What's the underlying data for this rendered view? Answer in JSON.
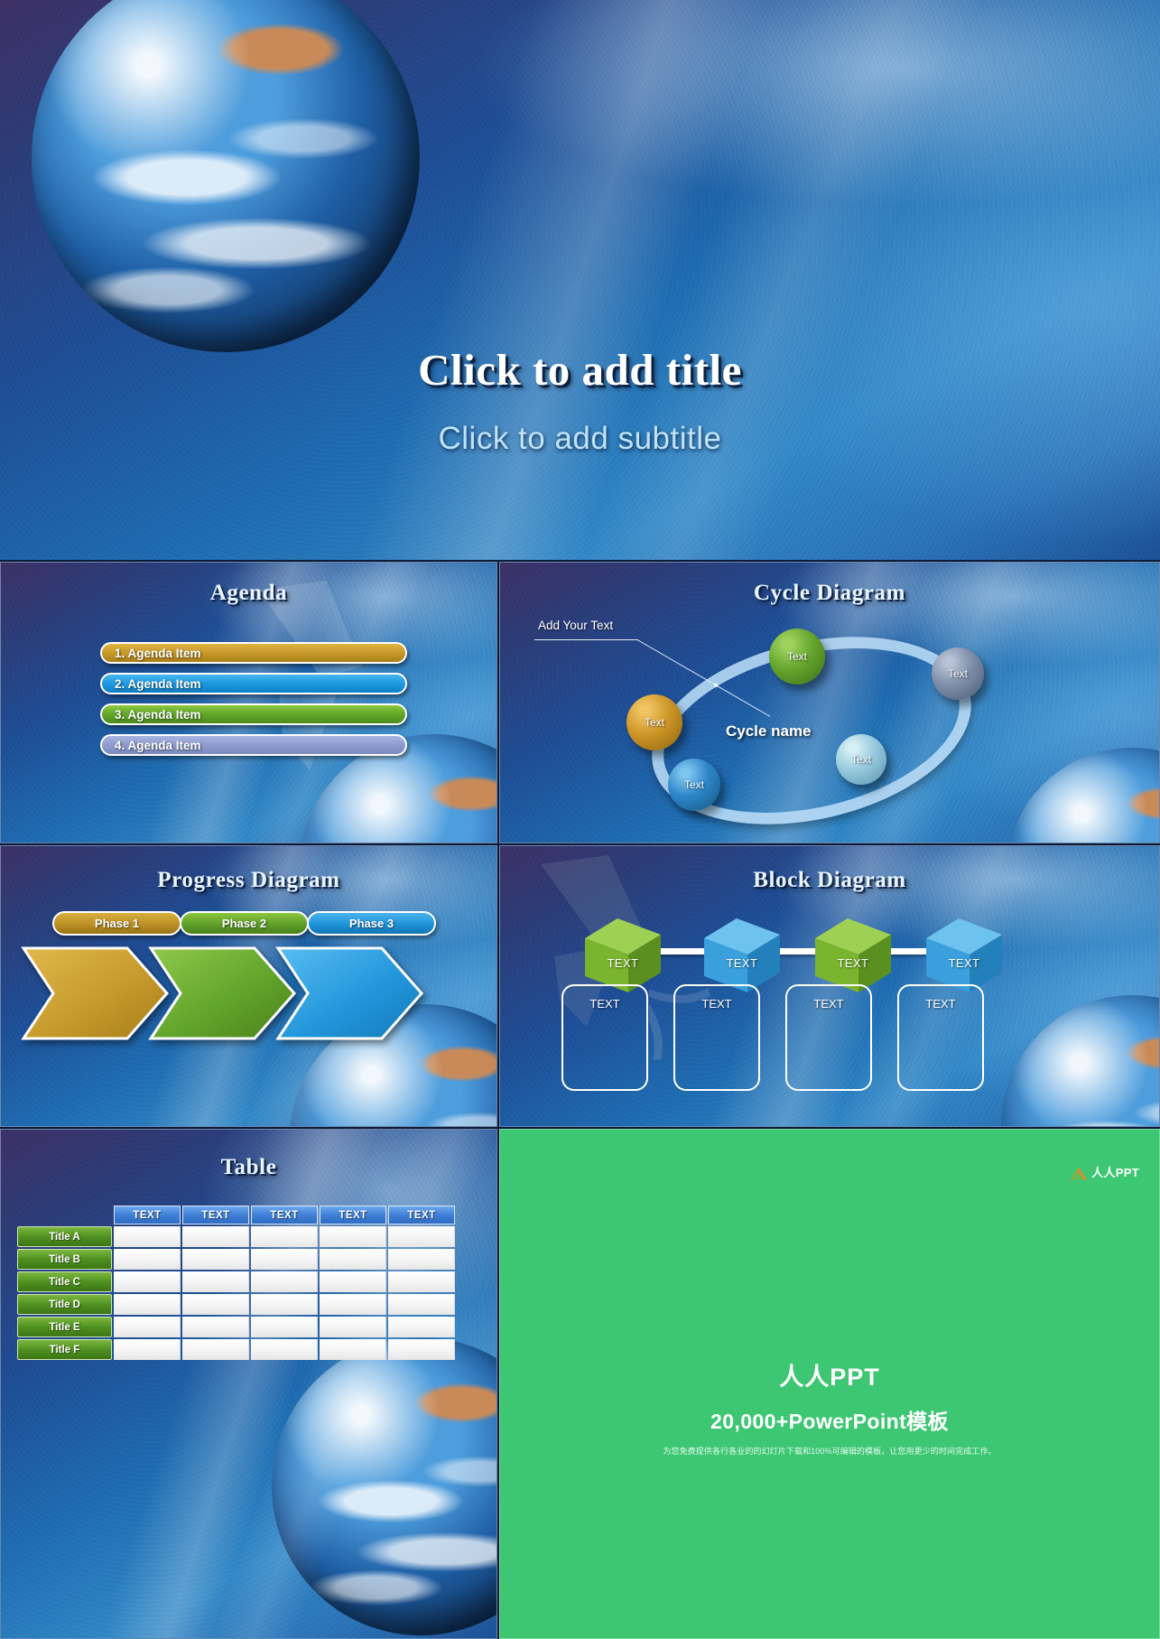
{
  "deck": {
    "title_slide": {
      "title": "Click to add title",
      "subtitle": "Click to add subtitle"
    },
    "slides": [
      {
        "name": "agenda",
        "heading": "Agenda",
        "items": [
          {
            "label": "1. Agenda Item",
            "color": "#c79a2a"
          },
          {
            "label": "2. Agenda Item",
            "color": "#1f9ae0"
          },
          {
            "label": "3. Agenda Item",
            "color": "#63a82b"
          },
          {
            "label": "4. Agenda Item",
            "color": "#8f9ccf"
          }
        ]
      },
      {
        "name": "cycle",
        "heading": "Cycle Diagram",
        "callout": "Add Your Text",
        "center_label": "Cycle name",
        "nodes": [
          {
            "label": "Text",
            "color": "#66a62e"
          },
          {
            "label": "Text",
            "color": "#7e8ea9"
          },
          {
            "label": "Text",
            "color": "#cd9626"
          },
          {
            "label": "Text",
            "color": "#96c9dd"
          },
          {
            "label": "Text",
            "color": "#2d86c8"
          }
        ]
      },
      {
        "name": "progress",
        "heading": "Progress Diagram",
        "phases": [
          {
            "label": "Phase 1",
            "color": "#bb9026"
          },
          {
            "label": "Phase 2",
            "color": "#5f9f2b"
          },
          {
            "label": "Phase 3",
            "color": "#1f93d8"
          }
        ]
      },
      {
        "name": "block",
        "heading": "Block Diagram",
        "cubes": [
          {
            "label": "TEXT",
            "color": "#7ab52f"
          },
          {
            "label": "TEXT",
            "color": "#39a0dd"
          },
          {
            "label": "TEXT",
            "color": "#7ab52f"
          },
          {
            "label": "TEXT",
            "color": "#39a0dd"
          }
        ],
        "boxes": [
          {
            "label": "TEXT"
          },
          {
            "label": "TEXT"
          },
          {
            "label": "TEXT"
          },
          {
            "label": "TEXT"
          }
        ]
      },
      {
        "name": "table",
        "heading": "Table",
        "table": {
          "column_headers": [
            "TEXT",
            "TEXT",
            "TEXT",
            "TEXT",
            "TEXT"
          ],
          "row_headers": [
            "Title  A",
            "Title  B",
            "Title  C",
            "Title  D",
            "Title  E",
            "Title  F"
          ],
          "cells": [
            [
              "",
              "",
              "",
              "",
              ""
            ],
            [
              "",
              "",
              "",
              "",
              ""
            ],
            [
              "",
              "",
              "",
              "",
              ""
            ],
            [
              "",
              "",
              "",
              "",
              ""
            ],
            [
              "",
              "",
              "",
              "",
              ""
            ],
            [
              "",
              "",
              "",
              "",
              ""
            ]
          ]
        }
      }
    ],
    "promo": {
      "logo_text": "人人PPT",
      "title": "人人PPT",
      "subtitle": "20,000+PowerPoint模板",
      "note": "为您免费提供各行各业的的幻灯片下载和100%可编辑的模板，让您用更少的时间完成工作。",
      "background_color": "#3dc773"
    }
  }
}
